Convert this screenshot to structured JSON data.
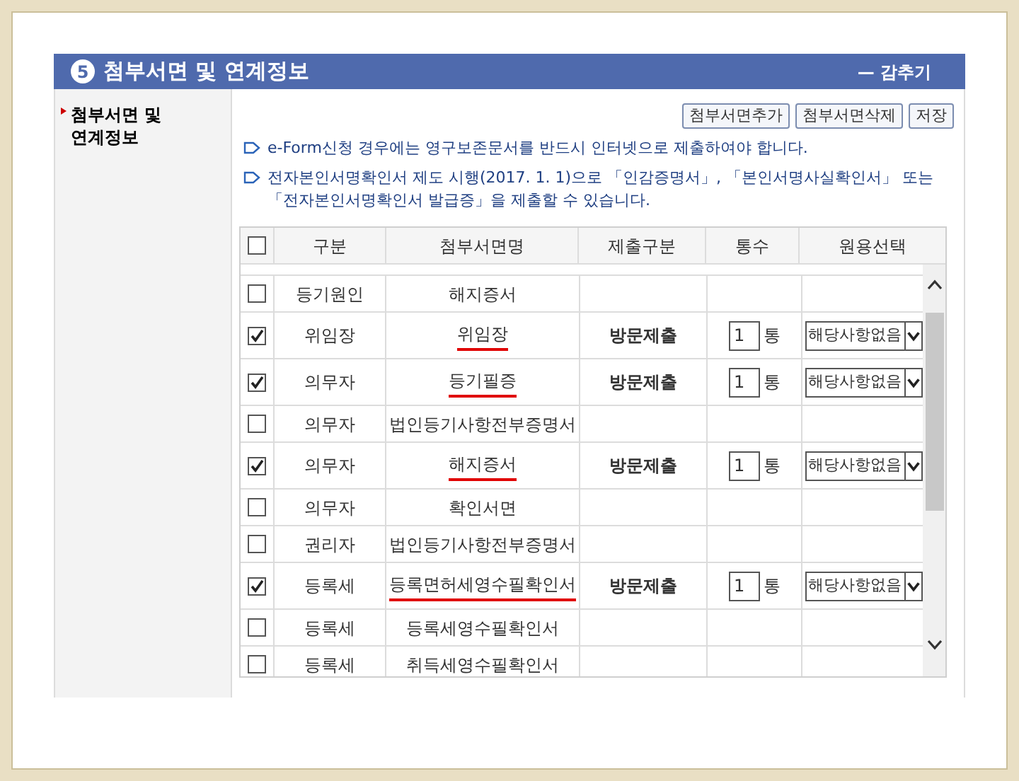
{
  "section": {
    "number": "5",
    "title": "첨부서면 및 연계정보",
    "collapse": "— 감추기"
  },
  "sidebar": {
    "items": [
      {
        "label": "첨부서면 및 연계정보",
        "selected": true
      }
    ]
  },
  "buttons": [
    "첨부서면추가",
    "첨부서면삭제",
    "저장"
  ],
  "notices": [
    "e-Form신청 경우에는 영구보존문서를 반드시 인터넷으로 제출하여야 합니다.",
    "전자본인서명확인서 제도 시행(2017. 1. 1)으로 「인감증명서」, 「본인서명사실확인서」 또는 「전자본인서명확인서 발급증」을 제출할 수 있습니다."
  ],
  "table": {
    "all_checked": false,
    "columns": [
      "구분",
      "첨부서면명",
      "제출구분",
      "통수",
      "원용선택"
    ],
    "rows": [
      {
        "kind": "plain",
        "checked": false,
        "category": "등기원인",
        "document": "해지증서",
        "marked": false
      },
      {
        "kind": "detail",
        "checked": true,
        "category": "위임장",
        "document": "위임장",
        "marked": true,
        "submission": "방문제출",
        "count": "1",
        "unit": "통",
        "option": "해당사항없음"
      },
      {
        "kind": "detail",
        "checked": true,
        "category": "의무자",
        "document": "등기필증",
        "marked": true,
        "submission": "방문제출",
        "count": "1",
        "unit": "통",
        "option": "해당사항없음"
      },
      {
        "kind": "plain",
        "checked": false,
        "category": "의무자",
        "document": "법인등기사항전부증명서",
        "marked": false
      },
      {
        "kind": "detail",
        "checked": true,
        "category": "의무자",
        "document": "해지증서",
        "marked": true,
        "submission": "방문제출",
        "count": "1",
        "unit": "통",
        "option": "해당사항없음"
      },
      {
        "kind": "plain",
        "checked": false,
        "category": "의무자",
        "document": "확인서면",
        "marked": false
      },
      {
        "kind": "plain",
        "checked": false,
        "category": "권리자",
        "document": "법인등기사항전부증명서",
        "marked": false
      },
      {
        "kind": "detail",
        "checked": true,
        "category": "등록세",
        "document": "등록면허세영수필확인서",
        "marked": true,
        "submission": "방문제출",
        "count": "1",
        "unit": "통",
        "option": "해당사항없음"
      },
      {
        "kind": "plain",
        "checked": false,
        "category": "등록세",
        "document": "등록세영수필확인서",
        "marked": false
      },
      {
        "kind": "plain",
        "checked": false,
        "category": "등록세",
        "document": "취득세영수필확인서",
        "marked": false
      }
    ]
  }
}
